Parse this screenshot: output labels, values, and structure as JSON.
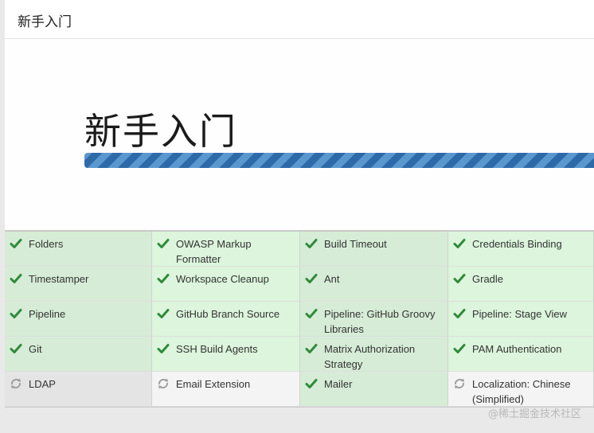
{
  "page": {
    "title": "新手入门"
  },
  "hero": {
    "title": "新手入门",
    "progress_percent": 100
  },
  "plugins": [
    {
      "name": "Folders",
      "status": "success"
    },
    {
      "name": "OWASP Markup Formatter",
      "status": "success"
    },
    {
      "name": "Build Timeout",
      "status": "success"
    },
    {
      "name": "Credentials Binding",
      "status": "success"
    },
    {
      "name": "Timestamper",
      "status": "success"
    },
    {
      "name": "Workspace Cleanup",
      "status": "success"
    },
    {
      "name": "Ant",
      "status": "success"
    },
    {
      "name": "Gradle",
      "status": "success"
    },
    {
      "name": "Pipeline",
      "status": "success"
    },
    {
      "name": "GitHub Branch Source",
      "status": "success"
    },
    {
      "name": "Pipeline: GitHub Groovy Libraries",
      "status": "success"
    },
    {
      "name": "Pipeline: Stage View",
      "status": "success"
    },
    {
      "name": "Git",
      "status": "success"
    },
    {
      "name": "SSH Build Agents",
      "status": "success"
    },
    {
      "name": "Matrix Authorization Strategy",
      "status": "success"
    },
    {
      "name": "PAM Authentication",
      "status": "success"
    },
    {
      "name": "LDAP",
      "status": "pending"
    },
    {
      "name": "Email Extension",
      "status": "pending"
    },
    {
      "name": "Mailer",
      "status": "success"
    },
    {
      "name": "Localization: Chinese (Simplified)",
      "status": "pending"
    }
  ],
  "icons": {
    "success": "check-icon",
    "pending": "spinner-icon"
  },
  "colors": {
    "success": "#2f8a3a",
    "pending": "#9a9a9a",
    "progress": "#3a7ab8"
  },
  "watermark": "@稀土掘金技术社区"
}
